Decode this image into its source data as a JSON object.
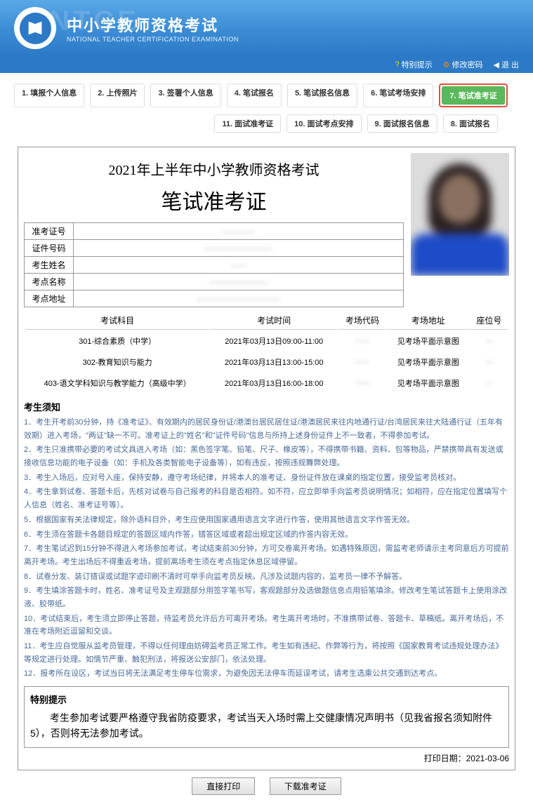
{
  "header": {
    "title": "中小学教师资格考试",
    "subtitle": "NATIONAL TEACHER CERTIFICATION EXAMINATION",
    "watermark": "NTCE"
  },
  "topbar": {
    "special": "特别提示",
    "password": "修改密码",
    "exit": "退 出"
  },
  "nav": {
    "row1": [
      {
        "label": "1. 填报个人信息"
      },
      {
        "label": "2. 上传照片"
      },
      {
        "label": "3. 签署个人信息"
      },
      {
        "label": "4. 笔试报名"
      },
      {
        "label": "5. 笔试报名信息"
      },
      {
        "label": "6. 笔试考场安排"
      },
      {
        "label": "7. 笔试准考证",
        "active": true
      }
    ],
    "row2": [
      {
        "label": "11. 面试准考证"
      },
      {
        "label": "10. 面试考点安排"
      },
      {
        "label": "9. 面试报名信息"
      },
      {
        "label": "8. 面试报名"
      }
    ]
  },
  "ticket": {
    "title1": "2021年上半年中小学教师资格考试",
    "title2": "笔试准考证",
    "fields": [
      {
        "label": "准考证号",
        "value": "————"
      },
      {
        "label": "证件号码",
        "value": "————————"
      },
      {
        "label": "考生姓名",
        "value": "——"
      },
      {
        "label": "考点名称",
        "value": "———————"
      },
      {
        "label": "考点地址",
        "value": "——————————"
      }
    ],
    "cols": [
      "考试科目",
      "考试时间",
      "考场代码",
      "考场地址",
      "座位号"
    ],
    "rows": [
      {
        "subject": "301-综合素质（中学）",
        "time": "2021年03月13日09:00-11:00",
        "code": "——",
        "addr": "见考场平面示意图",
        "seat": "—"
      },
      {
        "subject": "302-教育知识与能力",
        "time": "2021年03月13日13:00-15:00",
        "code": "——",
        "addr": "见考场平面示意图",
        "seat": "—"
      },
      {
        "subject": "403-语文学科知识与教学能力（高级中学）",
        "time": "2021年03月13日16:00-18:00",
        "code": "——",
        "addr": "见考场平面示意图",
        "seat": "—"
      }
    ]
  },
  "notice": {
    "title": "考生须知",
    "items": [
      "1．考生开考前30分钟，持《准考证》、有效期内的居民身份证/港澳台居民居住证/港澳居民来往内地通行证/台湾居民来往大陆通行证（五年有效期）进入考场，\"两证\"缺一不可。准考证上的\"姓名\"和\"证件号码\"信息与所持上述身份证件上不一致者，不得参加考试。",
      "2．考生只准携带必要的考试文具进入考场（如：黑色签字笔、铅笔、尺子、橡皮等），不得携带书籍、资料、包等物品，严禁携带具有发送或接收信息功能的电子设备（如：手机及各类智能电子设备等），如有违反，按照违规舞弊处理。",
      "3．考生入场后，应对号入座，保持安静，遵守考场纪律，并将本人的准考证、身份证件放在课桌的指定位置，接受监考员核对。",
      "4．考生拿到试卷、答题卡后，先核对试卷与自己报考的科目是否相符。如不符，应立即举手向监考员说明情况；如相符，应在指定位置填写个人信息（姓名、准考证号等）。",
      "5．根据国家有关法律规定，除外语科目外，考生应使用国家通用语言文字进行作答，使用其他语言文字作答无效。",
      "6．考生须在答题卡各题目规定的答题区域内作答，错答区域或者超出规定区域的作答内容无效。",
      "7．考生笔试迟到15分钟不得进入考场参加考试，考试结束前30分钟，方可交卷离开考场。如遇特殊原因，需监考老师请示主考同意后方可提前离开考场。考生出场后不得重返考场，提前离场考生须在考点指定休息区域停留。",
      "8．试卷分发、装订错误或试题字迹印刷不清时可举手向监考员反映。凡涉及试题内容的，监考员一律不予解答。",
      "9．考生填涂答题卡时，姓名、准考证号及主观题部分用签字笔书写，客观题部分及选做题信息点用铅笔填涂。修改考生笔试答题卡上使用涂改液、胶带纸。",
      "10．考试结束后，考生须立即停止答题，待监考员允许后方可离开考场。考生离开考场时，不准携带试卷、答题卡、草稿纸。离开考场后，不准在考场附近逗留和交谈。",
      "11．考生应自觉服从监考员管理，不得以任何理由妨碍监考员正常工作。考生如有违纪、作弊等行为，将按照《国家教育考试违规处理办法》等规定进行处理。如情节严重、触犯刑法，将报送公安部门，依法处理。",
      "12．报考所在设区，考试当日将无法满足考生停车位需求，为避免因无法停车而延误考试，请考生选乘公共交通到达考点。"
    ]
  },
  "special": {
    "title": "特别提示",
    "text": "考生参加考试要严格遵守我省防疫要求，考试当天入场时需上交健康情况声明书（见我省报名须知附件5），否则将无法参加考试。"
  },
  "footer": {
    "printDate": "打印日期：2021-03-06",
    "btnPrint": "直接打印",
    "btnDownload": "下载准考证"
  }
}
